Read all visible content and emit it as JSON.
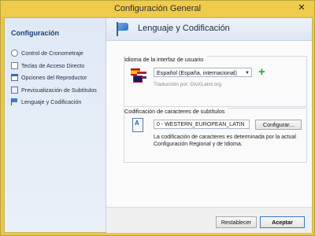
{
  "window": {
    "title": "Configuración General",
    "close_glyph": "✕"
  },
  "sidebar": {
    "title": "Configuración",
    "items": [
      {
        "label": "Control de Cronometraje",
        "icon": "clock-icon"
      },
      {
        "label": "Teclas de Acceso Directo",
        "icon": "keyboard-icon"
      },
      {
        "label": "Opciones del Reproductor",
        "icon": "player-icon"
      },
      {
        "label": "Previsualización de Subtítulos",
        "icon": "preview-icon"
      },
      {
        "label": "Lenguaje y Codificación",
        "icon": "flag-icon"
      }
    ]
  },
  "header": {
    "title": "Lenguaje y Codificación",
    "icon": "flag-icon"
  },
  "language_group": {
    "title": "Idioma de la interfaz de usuario",
    "selected_language": "Español (España, internacional)",
    "translator": "Traducción por: DivXLand.org",
    "add_icon": "plus-icon"
  },
  "encoding_group": {
    "title": "Codificación de caracteres de subtítulos",
    "value": "0 - WESTERN_EUROPEAN_LATIN",
    "configure_label": "Configurar...",
    "note": "La codificación de caracteres es determinada por la actual Configuración Regional y de Idioma."
  },
  "footer": {
    "reset_label": "Restablecer",
    "accept_label": "Aceptar"
  },
  "colors": {
    "title_bar": "#efcb4c",
    "accent": "#2d6fc0",
    "add_green": "#22aa22"
  }
}
